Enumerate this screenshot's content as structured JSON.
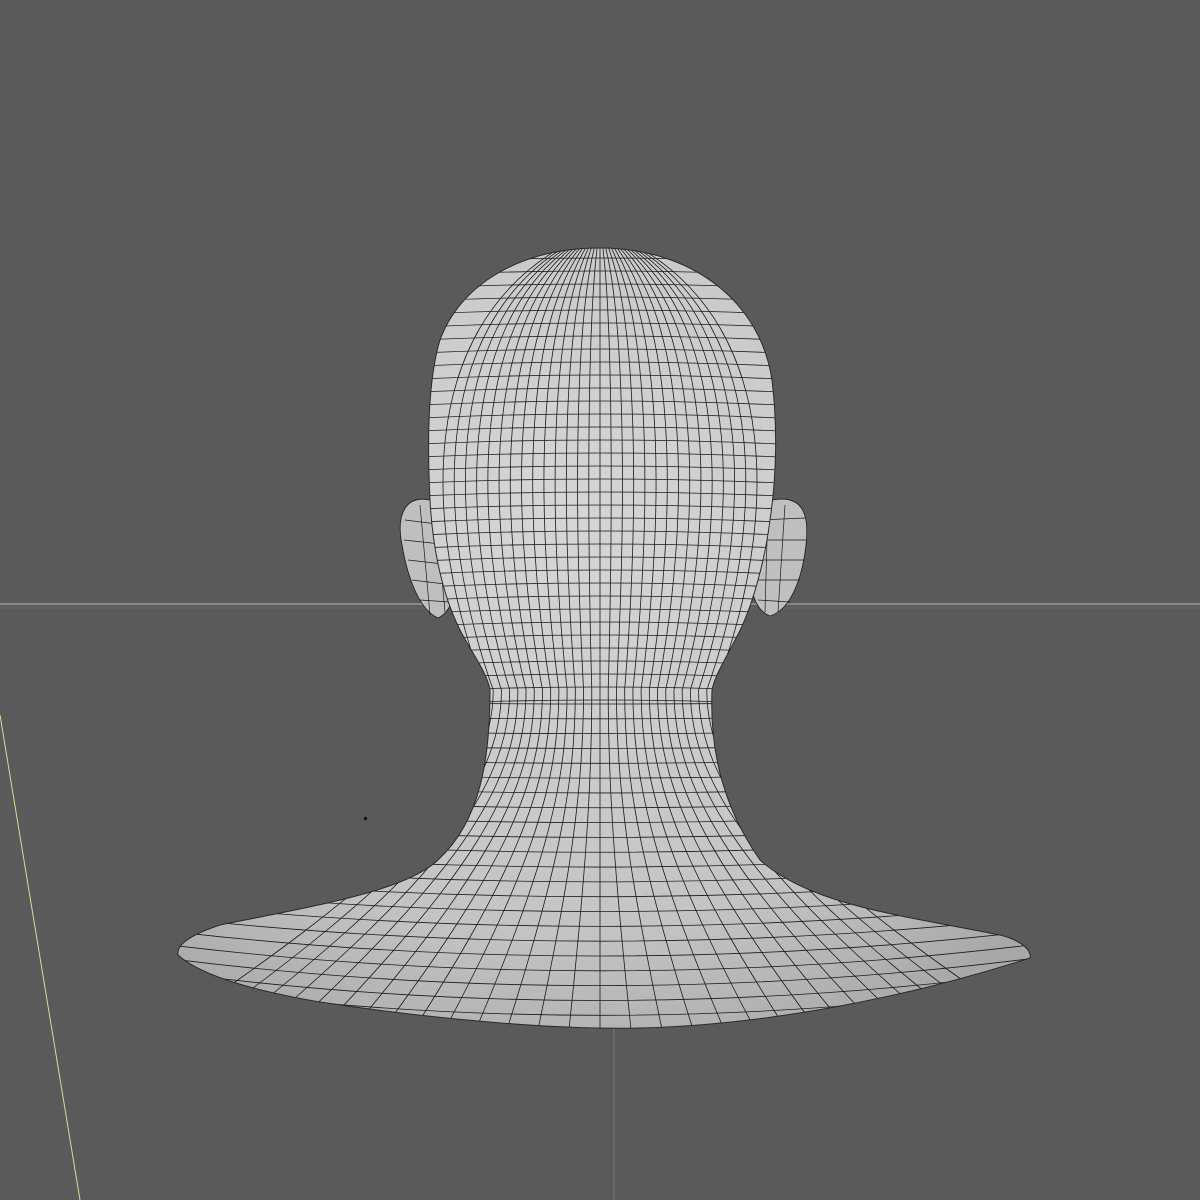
{
  "viewport": {
    "background_color": "#5a5a5a",
    "horizon_line_color": "#8a8a8a",
    "axis_line_color": "#d8d8a0",
    "grid_line_color": "#777777",
    "mesh_fill_color": "#c8c8c8",
    "wireframe_color": "#1a1a1a"
  },
  "model": {
    "name": "head-bust-mesh",
    "view": "back",
    "display": "wireframe-on-shaded"
  }
}
